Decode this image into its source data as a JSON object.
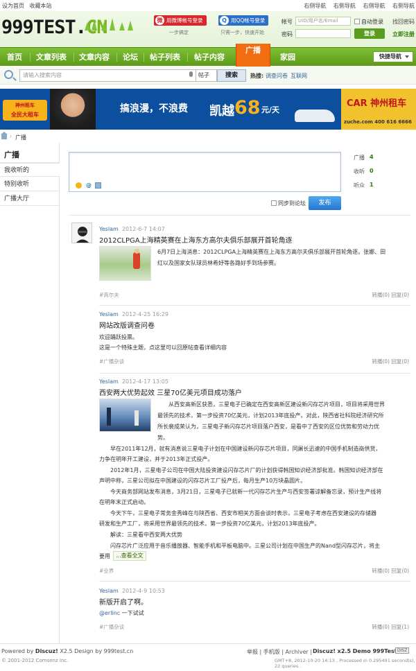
{
  "top": {
    "left_links": [
      "设为首页",
      "收藏本站"
    ],
    "right_links": [
      "右侧导航",
      "右侧导航",
      "右侧导航",
      "右侧导航"
    ]
  },
  "header": {
    "logo_main": "999TEST.",
    "logo_cn": "CN",
    "weibo_btn": "用微博帐号登录",
    "weibo_sub": "一步搞定",
    "qq_btn": "用QQ帐号登录",
    "qq_sub": "只需一步，快速开始",
    "account_label": "帐号",
    "account_placeholder": "UID/用户名/Email",
    "password_label": "密码",
    "auto_login": "自动登录",
    "forgot": "找回密码",
    "login_btn": "登录",
    "register": "立即注册"
  },
  "nav": {
    "items": [
      "首页",
      "文章列表",
      "文章内容",
      "论坛",
      "帖子列表",
      "帖子内容",
      "广播",
      "家园"
    ],
    "active": "广播",
    "quick_nav": "快捷导航"
  },
  "search": {
    "placeholder": "请输入搜索内容",
    "type": "帖子",
    "button": "搜索",
    "hot_label": "热搜:",
    "hot_links": [
      "调查问卷",
      "互联网"
    ]
  },
  "banner": {
    "tag_line1": "神州租车",
    "tag_line2": "全民大租车",
    "slogan": "搞浪漫，不浪费",
    "car": "凯越",
    "price": "68",
    "unit": "元/天",
    "brand": "CAR 神州租车",
    "url": "zuche.com  400 616 6666"
  },
  "breadcrumb": {
    "arrow": "›",
    "label": "广播"
  },
  "sidebar": {
    "title": "广播",
    "items": [
      "我收听的",
      "特别收听",
      "广播大厅"
    ]
  },
  "composer": {
    "sync": "同步到论坛",
    "post_btn": "发布"
  },
  "stats": [
    {
      "label": "广播",
      "value": "4"
    },
    {
      "label": "收听",
      "value": "0"
    },
    {
      "label": "听众",
      "value": "1"
    }
  ],
  "feed": [
    {
      "author": "Yeslam",
      "time": "2012-6-7 14:07",
      "title": "2012CLPGA上海精英赛在上海东方高尔夫俱乐部展开首轮角逐",
      "body_1": "6月7日上海消息：2012CLPGA上海精英赛在上海东方高尔夫俱乐部展开首轮角逐。张娜、田",
      "body_2": "红以及国家女队球员林希妤等各路好手到场参赛。",
      "tag": "#高尔夫",
      "actions": "转播(0)  回复(0)"
    },
    {
      "author": "Yeslam",
      "time": "2012-4-25 16:29",
      "title": "网站改版调查问卷",
      "body_1": "欢迎踊跃投票。",
      "body_2": "这是一个特殊主题，点这里可以回原帖查看详细内容",
      "tag": "#广播杂谈",
      "actions": "转播(0)  回复(0)"
    },
    {
      "author": "Yeslam",
      "time": "2012-4-17 13:05",
      "title": "西安两大优势起效 三星70亿美元项目成功落户",
      "p1a": "从西安高新区获悉，三星电子已确定在西安高新区建设新闪存芯片项目，项目将采用世界",
      "p1b": "最领先的技术，第一步投资70亿美元，计划2013年底投产。对此，陕西省社科院经济研究所",
      "p1c": "所长裴成荣认为，三星电子新闪存芯片项目落户西安，是看中了西安的区位优势和劳动力优",
      "p1d": "势。",
      "p2a": "早在2011年12月，就有消息说三星电子计划在中国建设新闪存芯片项目，同屠长迅速的中国手机制造商供货，",
      "p2b": "力争在明年开工建设，并于2013年正式投产。",
      "p3a": "2012年1月，三星电子公司在中国大陆投资建设闪存芯片厂的计划获得韩国知识经济部批准。韩国知识经济部在",
      "p3b": "声明中称，三星公司拟在中国建设的闪存芯片工厂投产后，每月生产10万块晶圆片。",
      "p4a": "今天商务部网站发布消息，3月21日，三星电子已就新一代闪存芯片生产与西安签署谅解备忘录，预计生产线将",
      "p4b": "在明年末正式启动。",
      "p5a": "今天下午，三星电子常务金秀峰在与陕西省、西安市相关方面会谈时表示，三星电子考虑在西安建设的存储器",
      "p5b": "研发和生产工厂，将采用世界最领先的技术，第一步投资70亿美元，计划2013年底投产。",
      "p6": "解读：三星看中西安两大优势",
      "p7a": "闪存芯片广泛应用于音乐播放器、智能手机和平板电脑中。三星公司计划在中国生产的Nand型闪存芯片，将主",
      "p7b": "要用",
      "more": "...查看全文",
      "tag": "#业界",
      "actions": "转播(0)  回复(0)"
    },
    {
      "author": "Yeslam",
      "time": "2012-4-9 10:53",
      "title": "新版开启了啊。",
      "mention": "@erlinc",
      "body_rest": "一下试试",
      "tag": "#广播杂谈",
      "actions": "转播(0)  回复(1)"
    }
  ],
  "footer": {
    "powered": "Powered by",
    "discuz": "Discuz!",
    "version": "X2.5 Design by 999test.cn",
    "copyright": "© 2001-2012 Comsenz Inc.",
    "links_text": "举报  |  手机版  |  Archiver  |",
    "demo": "Discuz! x2.5 Demo 999Test.cn",
    "badge": "DISZ",
    "gmt": "GMT+8, 2012-10-20 14:13 , Processed in 0.295491 second(s), 22 queries ."
  }
}
